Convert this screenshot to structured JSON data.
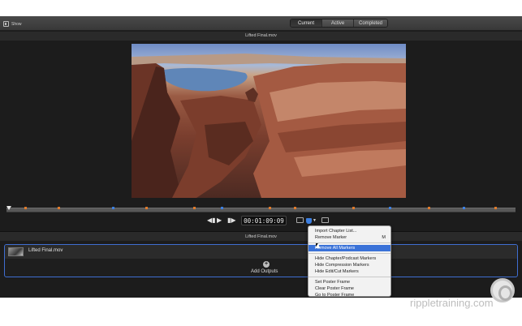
{
  "toolbar": {
    "show_label": "Show",
    "tabs": [
      {
        "label": "Current",
        "active": true
      },
      {
        "label": "Active",
        "active": false
      },
      {
        "label": "Completed",
        "active": false
      }
    ]
  },
  "viewer": {
    "title": "Lifted Final.mov",
    "timecode": "00:01:09:09"
  },
  "section": {
    "title": "Lifted Final.mov"
  },
  "job": {
    "file_name": "Lifted Final.mov",
    "add_outputs_label": "Add Outputs"
  },
  "marker_menu": {
    "items": [
      {
        "label": "Import Chapter List...",
        "shortcut": ""
      },
      {
        "label": "Remove Marker",
        "shortcut": "M"
      },
      {
        "label": "Remove All Markers",
        "shortcut": "",
        "highlighted": true
      },
      {
        "label": "Hide Chapter/Podcast Markers",
        "shortcut": ""
      },
      {
        "label": "Hide Compression Markers",
        "shortcut": ""
      },
      {
        "label": "Hide Edit/Cut Markers",
        "shortcut": ""
      },
      {
        "label": "Set Poster Frame",
        "shortcut": ""
      },
      {
        "label": "Clear Poster Frame",
        "shortcut": ""
      },
      {
        "label": "Go to Poster Frame",
        "shortcut": ""
      }
    ]
  },
  "watermark": {
    "text": "rippletraining.com"
  },
  "colors": {
    "accent": "#3a72d8",
    "marker_orange": "#e07a2a",
    "marker_blue": "#3d7fe0"
  }
}
